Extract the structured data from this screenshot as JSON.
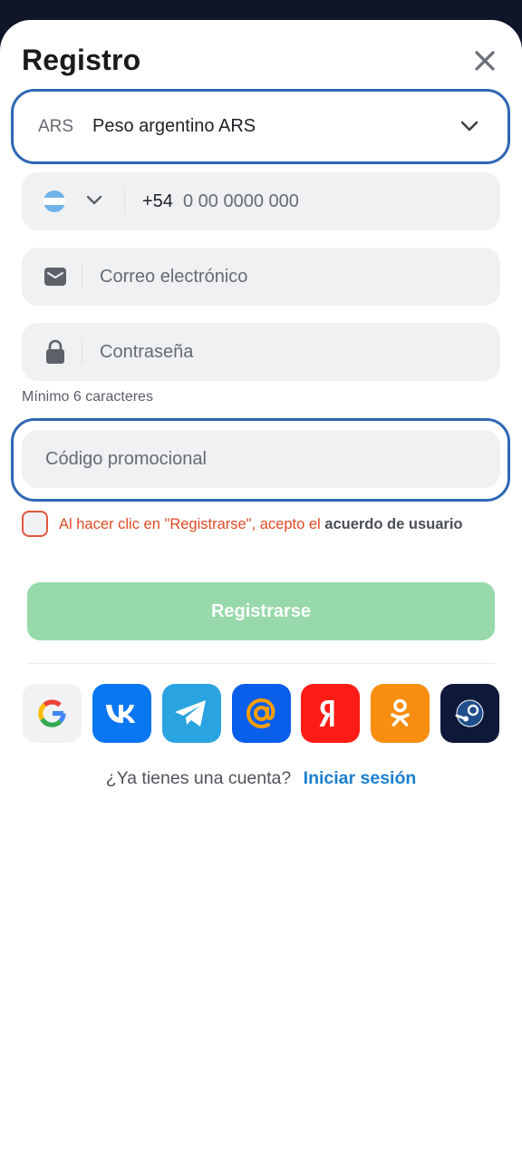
{
  "title": "Registro",
  "currency": {
    "code": "ARS",
    "name": "Peso argentino ARS"
  },
  "phone": {
    "prefix": "+54",
    "placeholder": "0 00 0000 000"
  },
  "email": {
    "placeholder": "Correo electrónico"
  },
  "password": {
    "placeholder": "Contraseña",
    "hint": "Mínimo 6 caracteres"
  },
  "promo": {
    "placeholder": "Código promocional"
  },
  "terms": {
    "text": "Al hacer clic en \"Registrarse\", acepto el",
    "link": "acuerdo de usuario"
  },
  "register_button": "Registrarse",
  "socials": [
    "google-icon",
    "vk-icon",
    "telegram-icon",
    "mailru-icon",
    "yandex-icon",
    "odnoklassniki-icon",
    "steam-icon"
  ],
  "login": {
    "question": "¿Ya tienes una cuenta?",
    "link": "Iniciar sesión"
  },
  "colors": {
    "accent": "#2f66b3",
    "register": "#97d9aa",
    "link": "#1a7fd0",
    "terms": "#df4a26",
    "backdrop": "#0e1628"
  }
}
